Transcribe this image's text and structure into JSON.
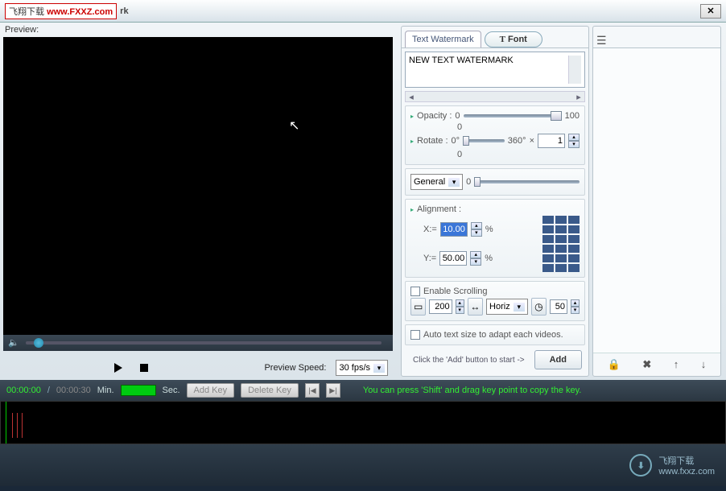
{
  "titlebar": {
    "logo_prefix": "飞翔下载 ",
    "logo_url": "www.FXXZ.com",
    "title_fragment": "rk",
    "close": "✕"
  },
  "preview": {
    "label": "Preview:"
  },
  "playback": {
    "speed_label": "Preview Speed:",
    "speed_value": "30 fps/s"
  },
  "tabs": {
    "text_watermark": "Text Watermark",
    "font": "Font"
  },
  "watermark_text": "NEW TEXT WATERMARK",
  "opacity": {
    "label": "Opacity :",
    "min": "0",
    "max": "100",
    "value": "0"
  },
  "rotate": {
    "label": "Rotate  :",
    "min": "0°",
    "max": "360°",
    "mult": "×",
    "value": "1",
    "out": "0"
  },
  "general": {
    "label": "General",
    "value": "0"
  },
  "alignment": {
    "label": "Alignment :",
    "x_label": "X:=",
    "x_value": "10.00",
    "y_label": "Y:=",
    "y_value": "50.00",
    "pct_icon": "%"
  },
  "scrolling": {
    "enable_label": "Enable Scrolling",
    "width_value": "200",
    "dir_value": "Horiz",
    "time_value": "50"
  },
  "autosize": {
    "label": "Auto text size to adapt each videos."
  },
  "footer": {
    "hint": "Click the 'Add' button to start ->",
    "add": "Add"
  },
  "layer_tools": {
    "lock": "🔒",
    "delete": "✖",
    "up": "↑",
    "down": "↓"
  },
  "timeline": {
    "current": "00:00:00",
    "sep": "/",
    "duration": "00:00:30",
    "min_label": "Min.",
    "sec_label": "Sec.",
    "add_key": "Add Key",
    "delete_key": "Delete Key",
    "prev": "|◀",
    "next": "▶|",
    "hint": "You can press 'Shift' and drag key point to copy the key."
  },
  "brand": {
    "name": "飞翔下载",
    "url": "www.fxxz.com"
  }
}
